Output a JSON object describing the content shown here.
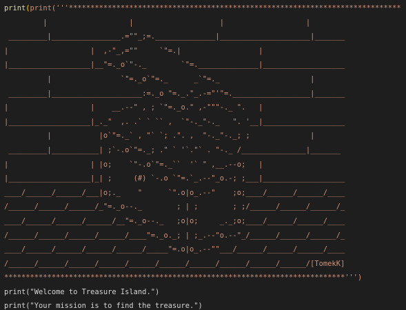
{
  "code": {
    "lines": [
      "print('''*****************************************************************************",
      "         |                   |                    |                   |",
      " _________|________________.=\"\"_;=.______________|_____________________|_______",
      "|                   |  ,-\"_,=\"\"     `\"=.|                  |",
      "|___________________|__\"=._o`\"-._        `\"=.______________|___________________",
      "          |                `\"=._o`\"=._      _`\"=._                     |",
      " _________|_____________________:=._o \"=._.\"_.-=\"'\"=.__________________|_______",
      "|                   |    __.--\" , ; `\"=._o.\" ,-\"\"\"-._ \".   |",
      "|___________________|_._\"  ,. .` ` `` ,  `\"-._\"-._   \". '__|___________________",
      "          |           |o`\"=._` , \"` `; .\". ,  \"-._\"-._; ;              |",
      " _________|___________| ;`-.o`\"=._; .\" ` '`.\"` . \"-._ /_______________|_______",
      "|                   | |o;    `\"-.o`\"=._``  '` \" ,__.--o;   |",
      "|___________________|_| ;     (#) `-.o `\"=.`_.--\"_o.-; ;___|___________________",
      "____/______/______/___|o;._    \"      `\".o|o_.--\"    ;o;____/______/______/____",
      "/______/______/______/_\"=._o--._        ; | ;        ; ;/______/______/______/_",
      "____/______/______/______/__\"=._o--._   ;o|o;     _._;o;____/______/______/____",
      "/______/______/______/______/____\"=._o._; | ;_.--\"o.--\"_/______/______/______/_",
      "____/______/______/______/______/_____\"=.o|o_.--\"\"___/______/______/______/____",
      "/______/______/______/______/______/______/______/______/______/______/[TomekK]",
      "*******************************************************************************''')",
      "print(\"Welcome to Treasure Island.\")",
      "print(\"Your mission is to find the treasure.\")"
    ]
  }
}
